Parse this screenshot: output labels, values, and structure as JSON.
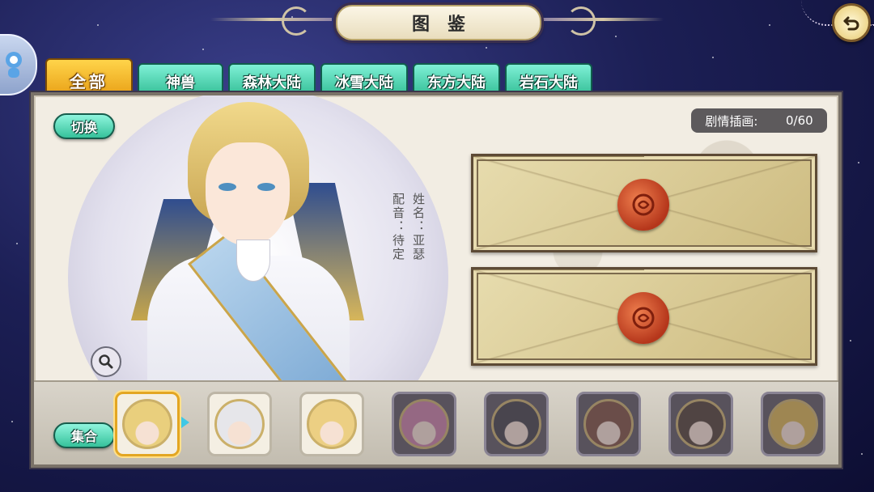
{
  "header": {
    "title": "图鉴"
  },
  "tabs": [
    {
      "label": "全部",
      "active": true
    },
    {
      "label": "神兽",
      "active": false
    },
    {
      "label": "森林大陆",
      "active": false
    },
    {
      "label": "冰雪大陆",
      "active": false
    },
    {
      "label": "东方大陆",
      "active": false
    },
    {
      "label": "岩石大陆",
      "active": false
    }
  ],
  "buttons": {
    "switch_label": "切换",
    "gather_label": "集合"
  },
  "character": {
    "name_line": "姓名：亚瑟",
    "voice_line": "配音：待定"
  },
  "story": {
    "label": "剧情插画:",
    "count": "0/60"
  },
  "letters": [
    {
      "state": "sealed"
    },
    {
      "state": "sealed"
    }
  ],
  "roster": [
    {
      "name": "blond-knight",
      "locked": false,
      "selected": true,
      "hair": "#e9cf7d"
    },
    {
      "name": "white-haired",
      "locked": false,
      "selected": false,
      "hair": "#e6e6ea"
    },
    {
      "name": "blond-prince",
      "locked": false,
      "selected": false,
      "hair": "#eccf83"
    },
    {
      "name": "pink-haired",
      "locked": true,
      "selected": false,
      "hair": "#c77aa4"
    },
    {
      "name": "dark-haired",
      "locked": true,
      "selected": false,
      "hair": "#3e3b44"
    },
    {
      "name": "brown-haired",
      "locked": true,
      "selected": false,
      "hair": "#7a4a3a"
    },
    {
      "name": "glasses",
      "locked": true,
      "selected": false,
      "hair": "#4a3a30"
    },
    {
      "name": "gold-haired",
      "locked": true,
      "selected": false,
      "hair": "#d8b24a"
    }
  ],
  "colors": {
    "tab_active": "#e69a10",
    "tab_inactive": "#2cb98f",
    "seal": "#b5361b"
  }
}
